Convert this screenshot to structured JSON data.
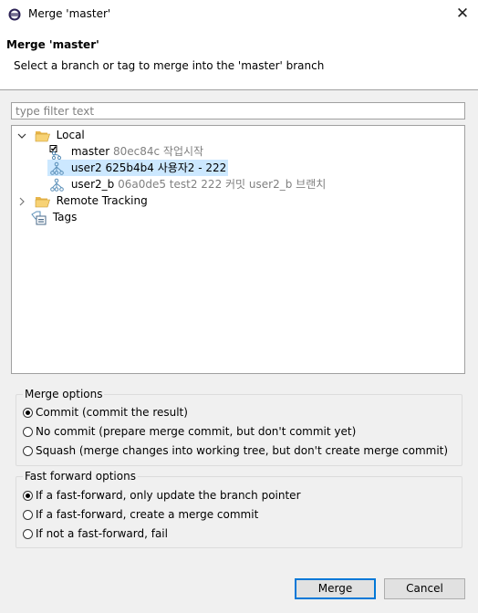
{
  "window": {
    "title": "Merge 'master'",
    "close_glyph": "✕"
  },
  "header": {
    "title": "Merge 'master'",
    "description": "Select a branch or tag to merge into the 'master' branch"
  },
  "filter": {
    "placeholder": "type filter text",
    "value": ""
  },
  "tree": {
    "local": {
      "label": "Local",
      "expanded": true
    },
    "branches": [
      {
        "name": "master",
        "detail": "80ec84c 작업시작",
        "checked_out": true,
        "selected": false
      },
      {
        "name": "user2",
        "detail": "625b4b4 사용자2 - 222",
        "checked_out": false,
        "selected": true
      },
      {
        "name": "user2_b",
        "detail": "06a0de5 test2 222 커밋 user2_b 브랜치",
        "checked_out": false,
        "selected": false
      }
    ],
    "remote": {
      "label": "Remote Tracking",
      "expanded": false
    },
    "tags": {
      "label": "Tags"
    }
  },
  "merge_options": {
    "label": "Merge options",
    "options": [
      {
        "label": "Commit (commit the result)",
        "checked": true
      },
      {
        "label": "No commit (prepare merge commit, but don't commit yet)",
        "checked": false
      },
      {
        "label": "Squash (merge changes into working tree, but don't create merge commit)",
        "checked": false
      }
    ]
  },
  "ff_options": {
    "label": "Fast forward options",
    "options": [
      {
        "label": "If a fast-forward, only update the branch pointer",
        "checked": true
      },
      {
        "label": "If a fast-forward, create a merge commit",
        "checked": false
      },
      {
        "label": "If not a fast-forward, fail",
        "checked": false
      }
    ]
  },
  "buttons": {
    "merge": "Merge",
    "cancel": "Cancel"
  },
  "colors": {
    "selection": "#cce8ff",
    "default_button_border": "#0078d7",
    "folder": "#e8b64c"
  }
}
